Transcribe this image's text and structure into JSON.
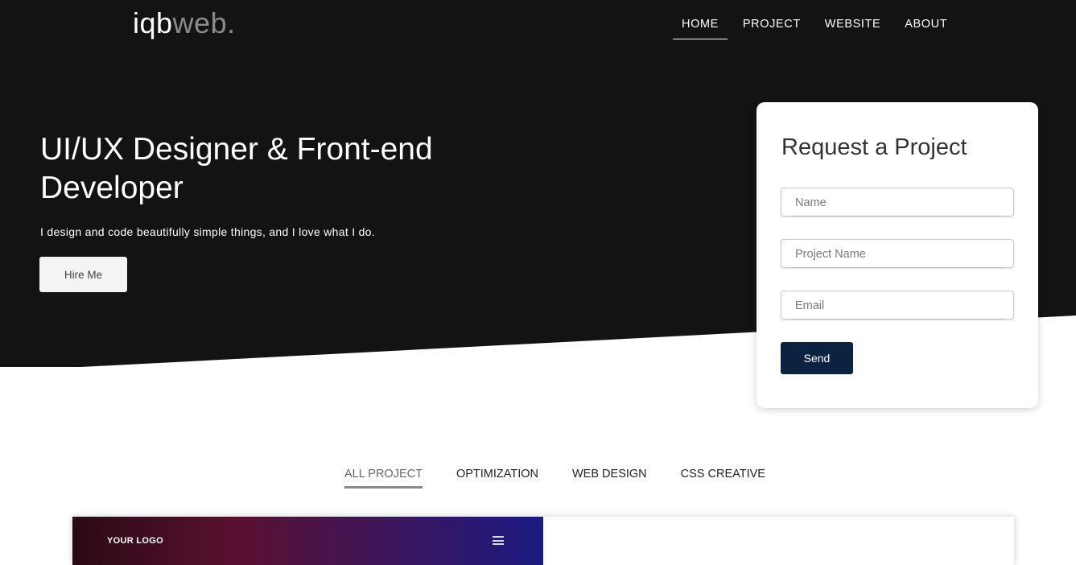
{
  "brand": {
    "part1": "iqb",
    "part2": "web."
  },
  "nav": {
    "items": [
      {
        "label": "HOME",
        "active": true
      },
      {
        "label": "PROJECT",
        "active": false
      },
      {
        "label": "WEBSITE",
        "active": false
      },
      {
        "label": "ABOUT",
        "active": false
      }
    ]
  },
  "hero": {
    "title": "UI/UX Designer & Front-end Developer",
    "subtitle": "I design and code beautifully simple things, and I love what I do.",
    "cta_label": "Hire Me"
  },
  "request_form": {
    "title": "Request a Project",
    "fields": [
      {
        "placeholder": "Name",
        "value": ""
      },
      {
        "placeholder": "Project Name",
        "value": ""
      },
      {
        "placeholder": "Email",
        "value": ""
      }
    ],
    "submit_label": "Send"
  },
  "filters": {
    "tabs": [
      {
        "label": "ALL PROJECT",
        "active": true
      },
      {
        "label": "OPTIMIZATION",
        "active": false
      },
      {
        "label": "WEB DESIGN",
        "active": false
      },
      {
        "label": "CSS CREATIVE",
        "active": false
      }
    ]
  },
  "gallery": {
    "items": [
      {
        "logo_text": "YOUR LOGO",
        "menu_icon": "hamburger-icon"
      }
    ]
  },
  "colors": {
    "hero_bg": "#131313",
    "send_button": "#0b2240",
    "card_bg": "#ffffff"
  }
}
